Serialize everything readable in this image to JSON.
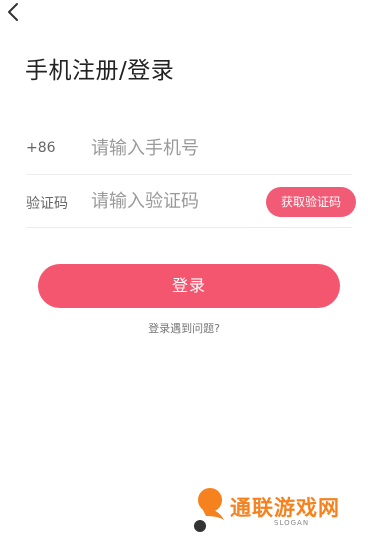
{
  "header": {
    "back_icon": "chevron-left-icon"
  },
  "page": {
    "title": "手机注册/登录"
  },
  "phone_row": {
    "prefix": "+86",
    "placeholder": "请输入手机号",
    "value": ""
  },
  "code_row": {
    "label": "验证码",
    "placeholder": "请输入验证码",
    "value": "",
    "get_code_label": "获取验证码"
  },
  "login": {
    "label": "登录"
  },
  "help": {
    "label": "登录遇到问题?"
  },
  "watermark": {
    "brand": "通联游戏网",
    "slogan": "SLOGAN"
  },
  "colors": {
    "accent": "#f4566f",
    "brand": "#f5821f"
  }
}
